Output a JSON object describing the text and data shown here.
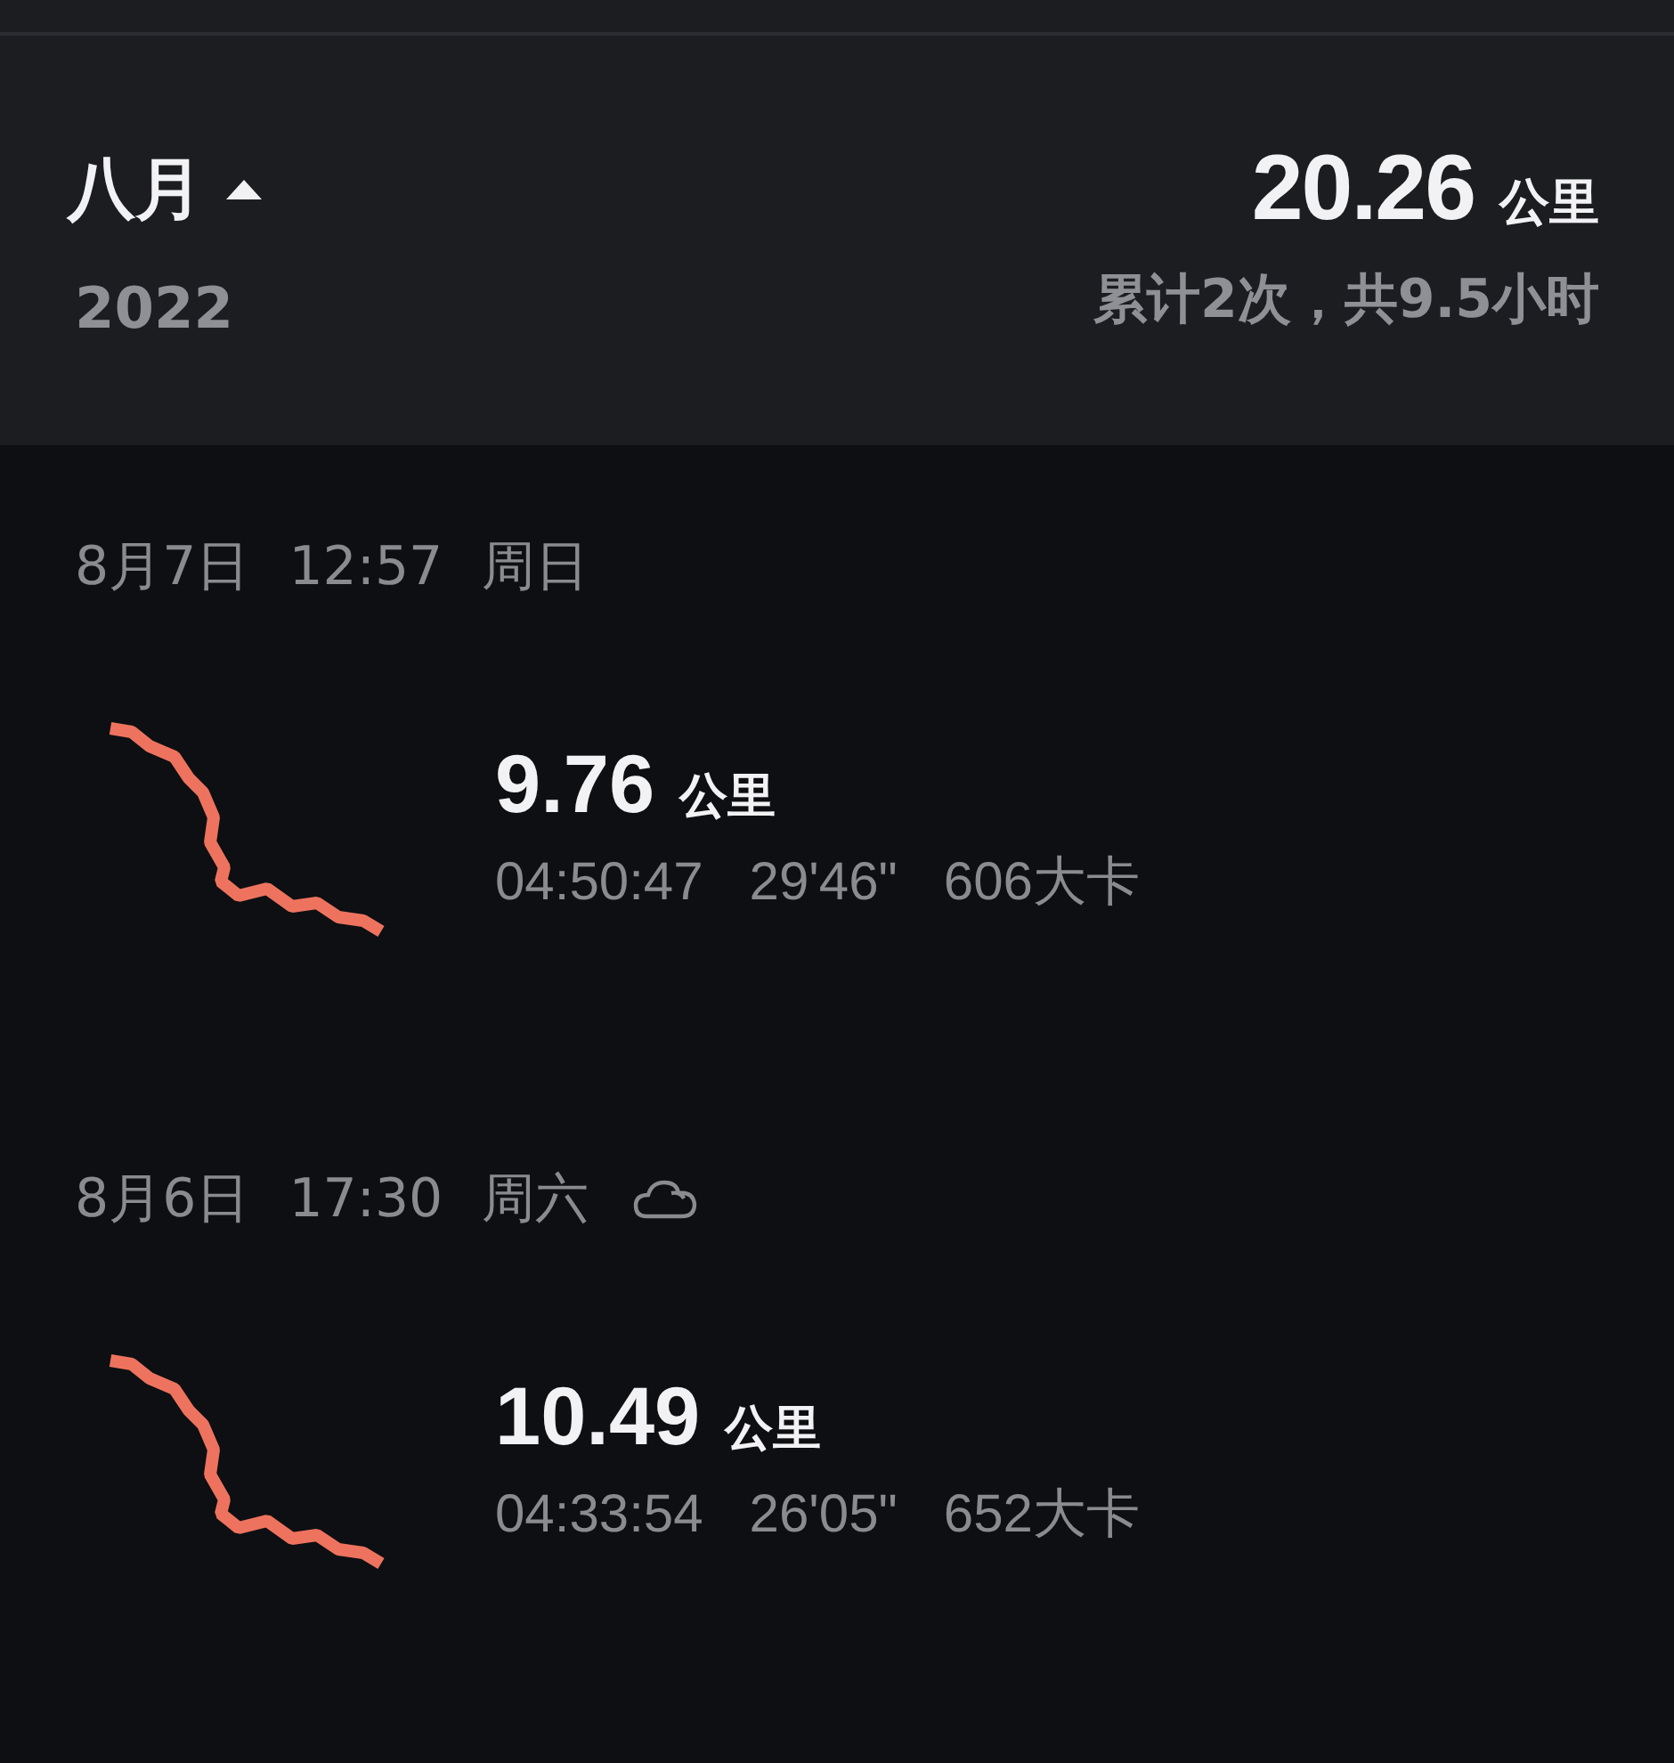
{
  "summary": {
    "month": "八月",
    "year": "2022",
    "distance": "20.26",
    "unit": "公里",
    "totals": "累计2次，共9.5小时"
  },
  "activities": [
    {
      "date": "8月7日",
      "time": "12:57",
      "weekday": "周日",
      "cloudy": false,
      "distance": "9.76",
      "unit": "公里",
      "duration": "04:50:47",
      "pace": "29'46\"",
      "calories": "606大卡"
    },
    {
      "date": "8月6日",
      "time": "17:30",
      "weekday": "周六",
      "cloudy": true,
      "distance": "10.49",
      "unit": "公里",
      "duration": "04:33:54",
      "pace": "26'05\"",
      "calories": "652大卡"
    }
  ]
}
